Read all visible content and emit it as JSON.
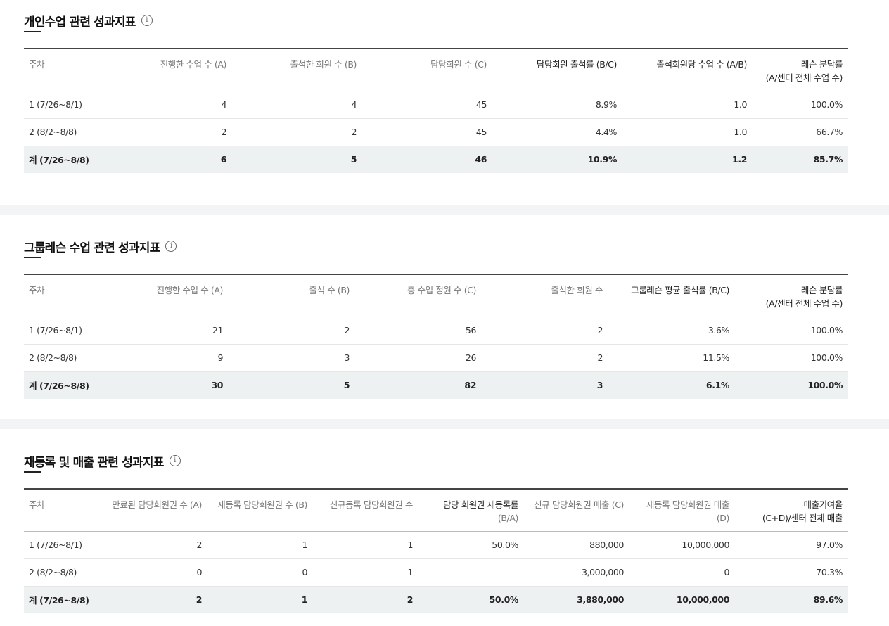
{
  "info_glyph": "i",
  "personal": {
    "title": "개인수업 관련 성과지표",
    "headers": [
      {
        "l1": "주차",
        "l2": ""
      },
      {
        "l1": "진행한 수업 수 (A)",
        "l2": ""
      },
      {
        "l1": "출석한 회원 수 (B)",
        "l2": ""
      },
      {
        "l1": "담당회원 수 (C)",
        "l2": ""
      },
      {
        "l1": "담당회원 출석률 (B/C)",
        "l2": ""
      },
      {
        "l1": "출석회원당 수업 수 (A/B)",
        "l2": ""
      },
      {
        "l1": "레슨 분담률",
        "l2": "(A/센터 전체 수업 수)"
      }
    ],
    "rows": [
      [
        "1 (7/26~8/1)",
        "4",
        "4",
        "45",
        "8.9%",
        "1.0",
        "100.0%"
      ],
      [
        "2 (8/2~8/8)",
        "2",
        "2",
        "45",
        "4.4%",
        "1.0",
        "66.7%"
      ]
    ],
    "total": [
      "계 (7/26~8/8)",
      "6",
      "5",
      "46",
      "10.9%",
      "1.2",
      "85.7%"
    ]
  },
  "group": {
    "title": "그룹레슨 수업 관련 성과지표",
    "headers": [
      {
        "l1": "주차",
        "l2": ""
      },
      {
        "l1": "진행한 수업 수 (A)",
        "l2": ""
      },
      {
        "l1": "출석 수 (B)",
        "l2": ""
      },
      {
        "l1": "총 수업 정원 수 (C)",
        "l2": ""
      },
      {
        "l1": "출석한 회원 수",
        "l2": ""
      },
      {
        "l1": "그룹레슨 평균 출석률 (B/C)",
        "l2": ""
      },
      {
        "l1": "레슨 분담률",
        "l2": "(A/센터 전체 수업 수)"
      }
    ],
    "rows": [
      [
        "1 (7/26~8/1)",
        "21",
        "2",
        "56",
        "2",
        "3.6%",
        "100.0%"
      ],
      [
        "2 (8/2~8/8)",
        "9",
        "3",
        "26",
        "2",
        "11.5%",
        "100.0%"
      ]
    ],
    "total": [
      "계 (7/26~8/8)",
      "30",
      "5",
      "82",
      "3",
      "6.1%",
      "100.0%"
    ]
  },
  "sales": {
    "title": "재등록 및 매출 관련 성과지표",
    "headers": [
      {
        "l1": "주차",
        "l2": ""
      },
      {
        "l1": "만료된 담당회원권 수 (A)",
        "l2": ""
      },
      {
        "l1": "재등록 담당회원권 수 (B)",
        "l2": ""
      },
      {
        "l1": "신규등록 담당회원권 수",
        "l2": ""
      },
      {
        "l1": "담당 회원권 재등록률",
        "l2": "(B/A)"
      },
      {
        "l1": "신규 담당회원권 매출 (C)",
        "l2": ""
      },
      {
        "l1": "재등록 담당회원권 매출",
        "l2": "(D)"
      },
      {
        "l1": "매출기여율",
        "l2": "(C+D)/센터 전체 매출"
      }
    ],
    "rows": [
      [
        "1 (7/26~8/1)",
        "2",
        "1",
        "1",
        "50.0%",
        "880,000",
        "10,000,000",
        "97.0%"
      ],
      [
        "2 (8/2~8/8)",
        "0",
        "0",
        "1",
        "-",
        "3,000,000",
        "0",
        "70.3%"
      ]
    ],
    "total": [
      "계 (7/26~8/8)",
      "2",
      "1",
      "2",
      "50.0%",
      "3,880,000",
      "10,000,000",
      "89.6%"
    ]
  }
}
